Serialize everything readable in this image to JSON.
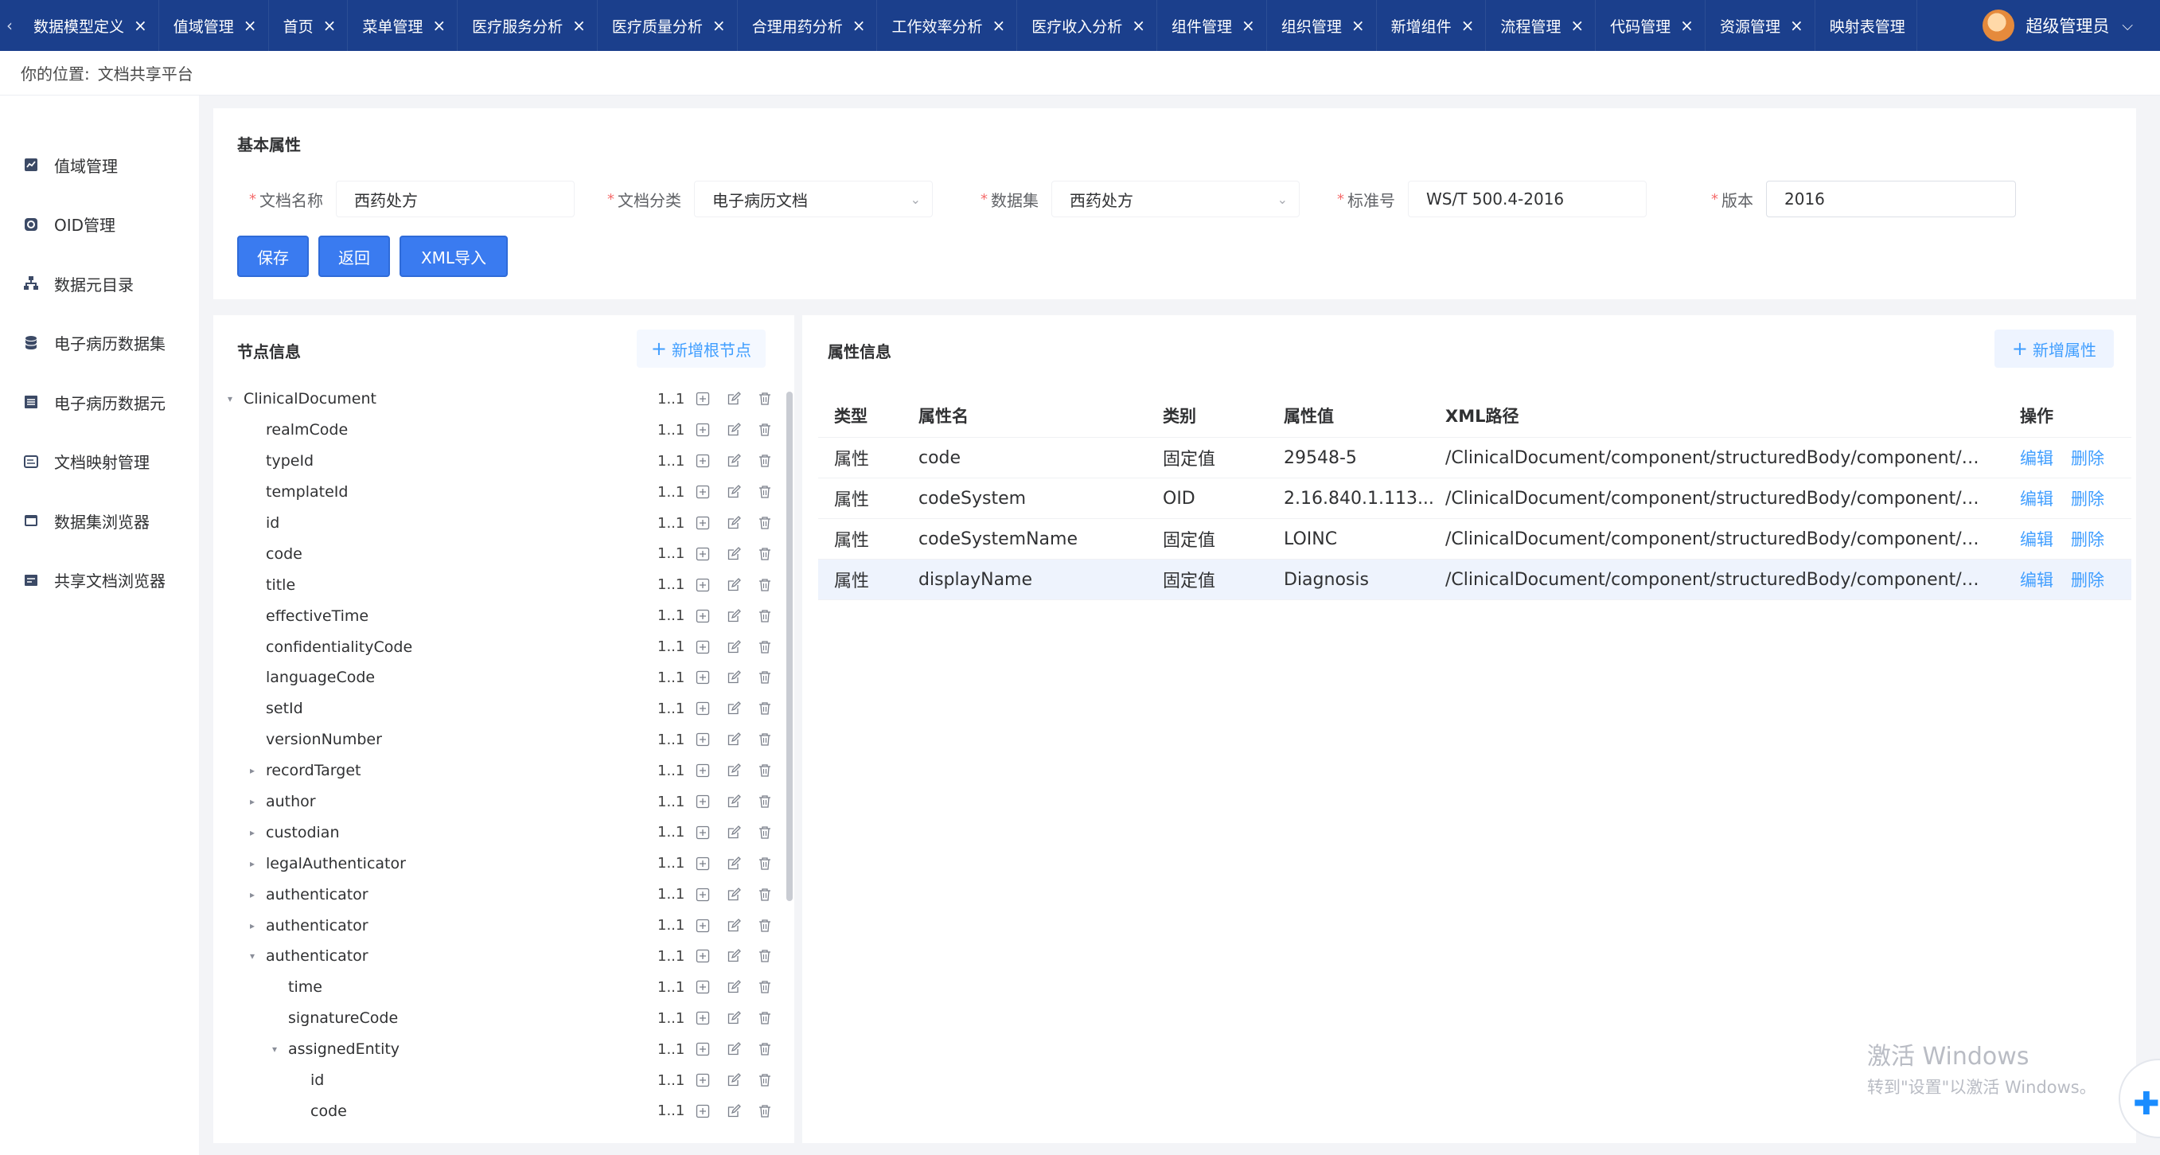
{
  "tabs": [
    {
      "label": "数据模型定义"
    },
    {
      "label": "值域管理"
    },
    {
      "label": "首页"
    },
    {
      "label": "菜单管理"
    },
    {
      "label": "医疗服务分析"
    },
    {
      "label": "医疗质量分析"
    },
    {
      "label": "合理用药分析"
    },
    {
      "label": "工作效率分析"
    },
    {
      "label": "医疗收入分析"
    },
    {
      "label": "组件管理"
    },
    {
      "label": "组织管理"
    },
    {
      "label": "新增组件"
    },
    {
      "label": "流程管理"
    },
    {
      "label": "代码管理"
    },
    {
      "label": "资源管理"
    },
    {
      "label": "映射表管理"
    }
  ],
  "user": {
    "name": "超级管理员"
  },
  "breadcrumb": {
    "prefix": "你的位置:",
    "current": "文档共享平台"
  },
  "sidebar": {
    "items": [
      {
        "label": "值域管理",
        "icon": "chart-icon"
      },
      {
        "label": "OID管理",
        "icon": "oid-icon"
      },
      {
        "label": "数据元目录",
        "icon": "hierarchy-icon"
      },
      {
        "label": "电子病历数据集",
        "icon": "database-icon"
      },
      {
        "label": "电子病历数据元",
        "icon": "list-icon"
      },
      {
        "label": "文档映射管理",
        "icon": "mapping-icon"
      },
      {
        "label": "数据集浏览器",
        "icon": "browser-icon"
      },
      {
        "label": "共享文档浏览器",
        "icon": "share-icon"
      }
    ]
  },
  "basic": {
    "title": "基本属性",
    "doc_name_label": "文档名称",
    "doc_name_value": "西药处方",
    "doc_category_label": "文档分类",
    "doc_category_value": "电子病历文档",
    "dataset_label": "数据集",
    "dataset_value": "西药处方",
    "standard_label": "标准号",
    "standard_value": "WS/T 500.4-2016",
    "version_label": "版本",
    "version_value": "2016",
    "required_mark": "*",
    "save_label": "保存",
    "back_label": "返回",
    "xml_import_label": "XML导入"
  },
  "nodes": {
    "title": "节点信息",
    "add_root_label": "新增根节点",
    "items": [
      {
        "label": "ClinicalDocument",
        "level": 0,
        "caret": "down",
        "card": "1..1"
      },
      {
        "label": "realmCode",
        "level": 1,
        "caret": "",
        "card": "1..1"
      },
      {
        "label": "typeId",
        "level": 1,
        "caret": "",
        "card": "1..1"
      },
      {
        "label": "templateId",
        "level": 1,
        "caret": "",
        "card": "1..1"
      },
      {
        "label": "id",
        "level": 1,
        "caret": "",
        "card": "1..1"
      },
      {
        "label": "code",
        "level": 1,
        "caret": "",
        "card": "1..1"
      },
      {
        "label": "title",
        "level": 1,
        "caret": "",
        "card": "1..1"
      },
      {
        "label": "effectiveTime",
        "level": 1,
        "caret": "",
        "card": "1..1"
      },
      {
        "label": "confidentialityCode",
        "level": 1,
        "caret": "",
        "card": "1..1"
      },
      {
        "label": "languageCode",
        "level": 1,
        "caret": "",
        "card": "1..1"
      },
      {
        "label": "setId",
        "level": 1,
        "caret": "",
        "card": "1..1"
      },
      {
        "label": "versionNumber",
        "level": 1,
        "caret": "",
        "card": "1..1"
      },
      {
        "label": "recordTarget",
        "level": 1,
        "caret": "right",
        "card": "1..1"
      },
      {
        "label": "author",
        "level": 1,
        "caret": "right",
        "card": "1..1"
      },
      {
        "label": "custodian",
        "level": 1,
        "caret": "right",
        "card": "1..1"
      },
      {
        "label": "legalAuthenticator",
        "level": 1,
        "caret": "right",
        "card": "1..1"
      },
      {
        "label": "authenticator",
        "level": 1,
        "caret": "right",
        "card": "1..1"
      },
      {
        "label": "authenticator",
        "level": 1,
        "caret": "right",
        "card": "1..1"
      },
      {
        "label": "authenticator",
        "level": 1,
        "caret": "down",
        "card": "1..1"
      },
      {
        "label": "time",
        "level": 2,
        "caret": "",
        "card": "1..1"
      },
      {
        "label": "signatureCode",
        "level": 2,
        "caret": "",
        "card": "1..1"
      },
      {
        "label": "assignedEntity",
        "level": 2,
        "caret": "down",
        "card": "1..1"
      },
      {
        "label": "id",
        "level": 3,
        "caret": "",
        "card": "1..1"
      },
      {
        "label": "code",
        "level": 3,
        "caret": "",
        "card": "1..1"
      }
    ]
  },
  "attrs": {
    "title": "属性信息",
    "add_label": "新增属性",
    "headers": [
      "类型",
      "属性名",
      "类别",
      "属性值",
      "XML路径",
      "操作"
    ],
    "edit_label": "编辑",
    "delete_label": "删除",
    "rows": [
      {
        "type": "属性",
        "name": "code",
        "category": "固定值",
        "value": "29548-5",
        "path": "/ClinicalDocument/component/structuredBody/component/sectio..."
      },
      {
        "type": "属性",
        "name": "codeSystem",
        "category": "OID",
        "value": "2.16.840.1.113...",
        "path": "/ClinicalDocument/component/structuredBody/component/sectio..."
      },
      {
        "type": "属性",
        "name": "codeSystemName",
        "category": "固定值",
        "value": "LOINC",
        "path": "/ClinicalDocument/component/structuredBody/component/sectio..."
      },
      {
        "type": "属性",
        "name": "displayName",
        "category": "固定值",
        "value": "Diagnosis",
        "path": "/ClinicalDocument/component/structuredBody/component/sectio..."
      }
    ]
  },
  "watermark": {
    "line1": "激活 Windows",
    "line2": "转到\"设置\"以激活 Windows。"
  },
  "colors": {
    "topbar": "#1b3f8c",
    "primary": "#3a7bf0",
    "link": "#409eff",
    "highlight_row": "#eef3fd"
  }
}
